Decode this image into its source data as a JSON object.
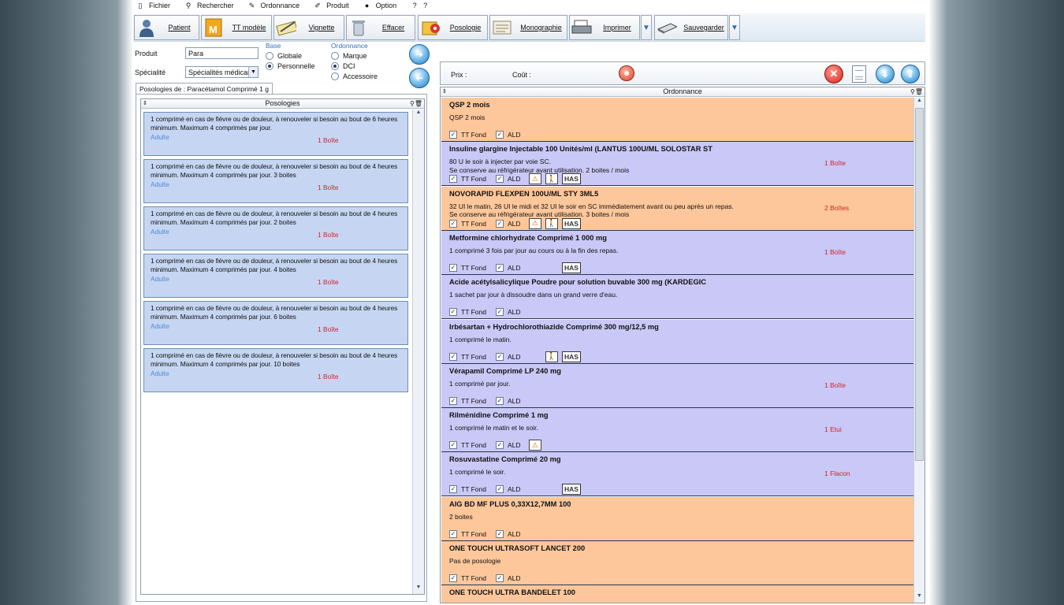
{
  "menu": [
    {
      "icon": "file-icon",
      "glyph": "▯",
      "label": "Fichier"
    },
    {
      "icon": "search-icon",
      "glyph": "⚲",
      "label": "Rechercher"
    },
    {
      "icon": "prescription-icon",
      "glyph": "✎",
      "label": "Ordonnance"
    },
    {
      "icon": "product-icon",
      "glyph": "✐",
      "label": "Produit"
    },
    {
      "icon": "option-icon",
      "glyph": "●",
      "label": "Option"
    },
    {
      "icon": "help-icon",
      "glyph": "?",
      "label": "?"
    }
  ],
  "toolbar": {
    "patient": "Patient",
    "tt_modele": "TT modèle",
    "vignette": "Vignette",
    "effacer": "Effacer",
    "posologie": "Posologie",
    "monographie": "Monographie",
    "imprimer": "Imprimer",
    "sauvegarder": "Sauvegarder"
  },
  "search": {
    "produit_label": "Produit",
    "produit_value": "Para",
    "specialite_label": "Spécialité",
    "specialite_value": "Spécialités médicam"
  },
  "base": {
    "title": "Base",
    "options": [
      "Globale",
      "Personnelle"
    ],
    "selected": "Personnelle"
  },
  "ordonnance_opt": {
    "title": "Ordonnance",
    "options": [
      "Marque",
      "DCI",
      "Accessoire"
    ],
    "selected": "DCI"
  },
  "left": {
    "tab": "Posologies de : Paracétamol Comprimé 1 g",
    "header": "Posologies",
    "items": [
      {
        "text": "1 comprimé en cas de fièvre ou de douleur, à renouveler si besoin au bout de 6 heures minimum. Maximum 4 comprimés par jour.",
        "target": "Adulte",
        "qty": "1 Boîte"
      },
      {
        "text": "1 comprimé en cas de fièvre ou de douleur, à renouveler si besoin au bout de 4 heures minimum. Maximum 4 comprimés par jour.   3 boites",
        "target": "Adulte",
        "qty": "1 Boîte"
      },
      {
        "text": "1 comprimé en cas de fièvre ou de douleur, à renouveler si besoin au bout de 4 heures minimum. Maximum 4 comprimés par jour.      2 boites",
        "target": "Adulte",
        "qty": "1 Boîte"
      },
      {
        "text": "1 comprimé en cas de fièvre ou de douleur, à renouveler si besoin au bout de 4 heures minimum. Maximum 4 comprimés par jour.      4 boites",
        "target": "Adulte",
        "qty": "1 Boîte"
      },
      {
        "text": "1 comprimé en cas de fièvre ou de douleur, à renouveler si besoin au bout de 4 heures minimum. Maximum 4 comprimés par jour.      6 boites",
        "target": "Adulte",
        "qty": "1 Boîte"
      },
      {
        "text": "1 comprimé en cas de fièvre ou de douleur, à renouveler si besoin au bout de 4 heures minimum. Maximum 4 comprimés par jour.      10 boites",
        "target": "Adulte",
        "qty": "1 Boîte"
      }
    ]
  },
  "right": {
    "prix_label": "Prix :",
    "cout_label": "Coût :",
    "header": "Ordonnance",
    "tt_fond": "TT Fond",
    "ald": "ALD",
    "has": "HAS",
    "rows": [
      {
        "color": "o",
        "title": "QSP 2 mois",
        "poso": [
          "QSP 2 mois"
        ],
        "qty": "",
        "warn": false,
        "walk": false,
        "has": false
      },
      {
        "color": "b",
        "title": "Insuline glargine Injectable 100 Unités/ml (LANTUS 100U/ML SOLOSTAR ST",
        "poso": [
          "80 U le soir à injecter par voie SC.",
          "Se conserve au réfrigérateur avant utilisation.   2 boites / mois"
        ],
        "qty": "1 Boîte",
        "warn": true,
        "walk": true,
        "has": true
      },
      {
        "color": "o",
        "title": "NOVORAPID FLEXPEN 100U/ML STY 3ML5",
        "poso": [
          "32 UI le matin, 26 UI le midi et 32 UI le soir en SC immédiatement avant ou peu après un repas.",
          "Se conserve au réfrigérateur avant utilisation.   3 boites / mois"
        ],
        "qty": "2 Boîtes",
        "warn": true,
        "walk": true,
        "has": true
      },
      {
        "color": "b",
        "title": "Metformine chlorhydrate Comprimé 1 000 mg",
        "poso": [
          "1 comprimé 3 fois par jour au cours ou à la fin des repas."
        ],
        "qty": "1 Boîte",
        "warn": false,
        "walk": false,
        "has": true
      },
      {
        "color": "b",
        "title": "Acide acétylsalicylique Poudre pour solution buvable 300 mg (KARDEGIC",
        "poso": [
          "1 sachet par jour à dissoudre dans un grand verre d'eau."
        ],
        "qty": "",
        "warn": false,
        "walk": false,
        "has": false
      },
      {
        "color": "b",
        "title": "Irbésartan + Hydrochlorothiazide Comprimé 300 mg/12,5 mg",
        "poso": [
          "1 comprimé le matin."
        ],
        "qty": "",
        "warn": false,
        "walk": true,
        "has": true
      },
      {
        "color": "b",
        "title": "Vérapamil Comprimé LP 240 mg",
        "poso": [
          "1 comprimé par jour."
        ],
        "qty": "1 Boîte",
        "warn": false,
        "walk": false,
        "has": false
      },
      {
        "color": "b",
        "title": "Rilménidine Comprimé 1 mg",
        "poso": [
          "1 comprimé le matin et le soir."
        ],
        "qty": "1 Etui",
        "warn": true,
        "walk": false,
        "has": false
      },
      {
        "color": "b",
        "title": "Rosuvastatine Comprimé 20 mg",
        "poso": [
          "1 comprimé le soir."
        ],
        "qty": "1 Flacon",
        "warn": false,
        "walk": false,
        "has": true
      },
      {
        "color": "o",
        "title": "AIG BD MF PLUS 0,33X12,7MM 100",
        "poso": [
          "2 boites"
        ],
        "qty": "",
        "warn": false,
        "walk": false,
        "has": false
      },
      {
        "color": "o",
        "title": "ONE TOUCH ULTRASOFT LANCET 200",
        "poso": [
          "Pas de posologie"
        ],
        "qty": "",
        "warn": false,
        "walk": false,
        "has": false
      },
      {
        "color": "o",
        "title": "ONE TOUCH ULTRA BANDELET 100",
        "poso": [
          "Pas de posologie"
        ],
        "qty": "",
        "warn": false,
        "walk": false,
        "has": false
      }
    ]
  }
}
